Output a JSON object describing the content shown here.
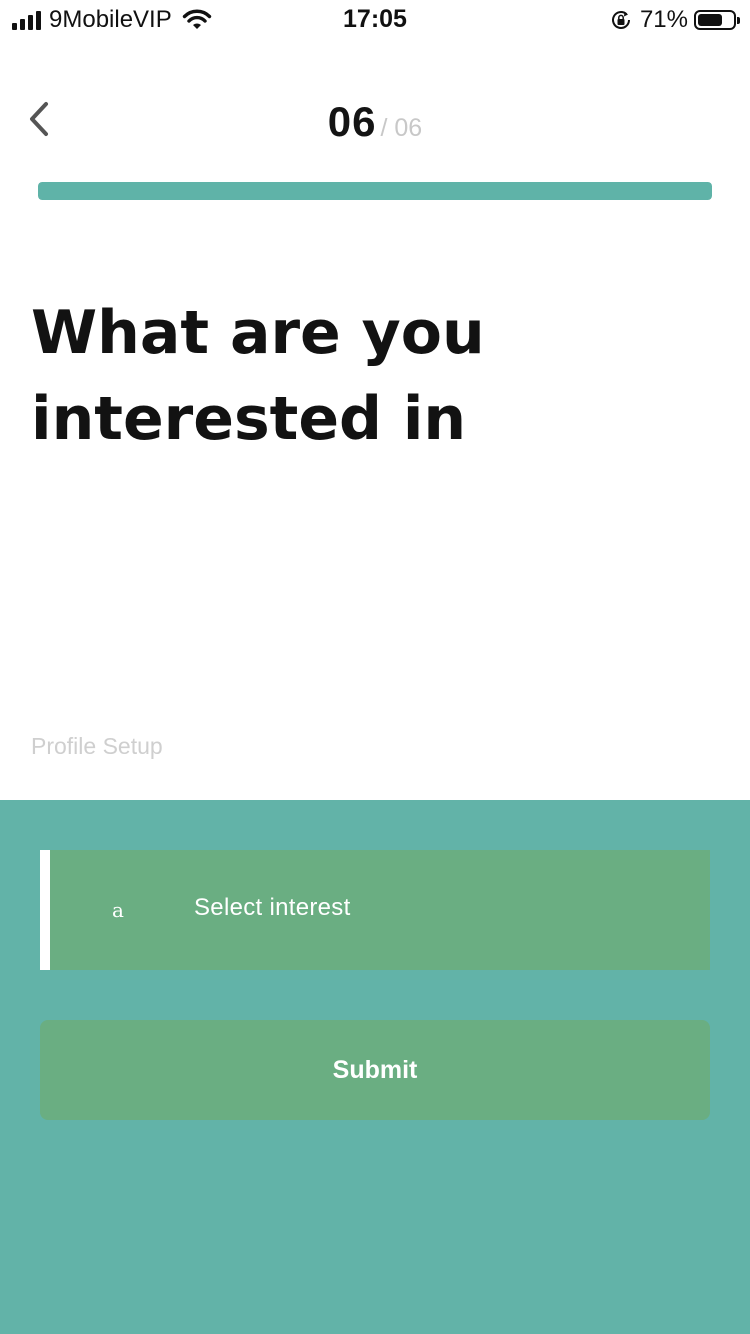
{
  "status_bar": {
    "carrier": "9MobileVIP",
    "time": "17:05",
    "battery_percent": "71%",
    "battery_level": 0.71,
    "icons": [
      "signal-icon",
      "wifi-icon",
      "rotation-lock-icon",
      "battery-icon"
    ]
  },
  "header": {
    "back_icon": "chevron-left-icon",
    "step_current": "06",
    "step_total": "/ 06",
    "progress": 1.0,
    "progress_color": "#5fb3a8"
  },
  "question": {
    "title": "What are you interested in"
  },
  "section_label": "Profile Setup",
  "form": {
    "panel_color": "#62b3a8",
    "field_color": "#6aae82",
    "select": {
      "icon_text": "a",
      "placeholder": "Select interest"
    },
    "submit_label": "Submit"
  }
}
